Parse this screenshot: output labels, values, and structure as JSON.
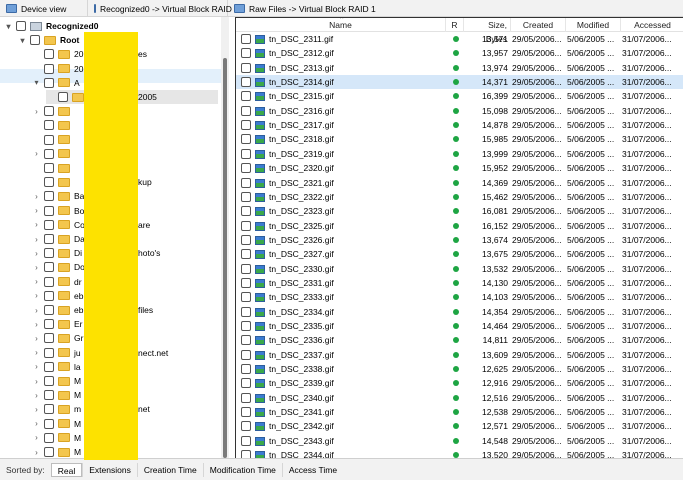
{
  "tabs": [
    {
      "label": "Device view"
    },
    {
      "label": "Recognized0 -> Virtual Block RAID 1"
    },
    {
      "label": "Raw Files -> Virtual Block RAID 1"
    }
  ],
  "tree": [
    {
      "label": "Recognized0",
      "bold": true,
      "expander": "▾"
    },
    {
      "label": "Root",
      "bold": true,
      "expander": "▾"
    },
    {
      "label": "20",
      "tail": "es"
    },
    {
      "label": "20"
    },
    {
      "label": "A",
      "expander": "▾"
    },
    {
      "label": "",
      "tail": "2005"
    },
    {
      "label": "",
      "expander": "›"
    },
    {
      "label": ""
    },
    {
      "label": ""
    },
    {
      "label": "",
      "expander": "›"
    },
    {
      "label": ""
    },
    {
      "label": "",
      "tail": "kup"
    },
    {
      "label": "Ba",
      "expander": "›"
    },
    {
      "label": "Bo",
      "expander": "›"
    },
    {
      "label": "Co",
      "tail": "are",
      "expander": "›"
    },
    {
      "label": "Da",
      "expander": "›"
    },
    {
      "label": "Di",
      "tail": "hoto's",
      "expander": "›"
    },
    {
      "label": "Do",
      "expander": "›"
    },
    {
      "label": "dr",
      "expander": "›"
    },
    {
      "label": "eb",
      "expander": "›"
    },
    {
      "label": "eb",
      "tail": "files",
      "expander": "›"
    },
    {
      "label": "Er",
      "expander": "›"
    },
    {
      "label": "Gr",
      "expander": "›"
    },
    {
      "label": "ju",
      "tail": "nect.net",
      "expander": "›"
    },
    {
      "label": "la",
      "expander": "›"
    },
    {
      "label": "M",
      "expander": "›"
    },
    {
      "label": "M",
      "expander": "›"
    },
    {
      "label": "m",
      "tail": "net",
      "expander": "›"
    },
    {
      "label": "M",
      "expander": "›"
    },
    {
      "label": "M",
      "expander": "›"
    },
    {
      "label": "M",
      "expander": "›"
    }
  ],
  "columns": {
    "name": "Name",
    "r": "R",
    "size": "Size, Bytes",
    "created": "Created",
    "modified": "Modified",
    "accessed": "Accessed"
  },
  "files": [
    {
      "name": "tn_DSC_2311.gif",
      "size": "13,571"
    },
    {
      "name": "tn_DSC_2312.gif",
      "size": "13,957"
    },
    {
      "name": "tn_DSC_2313.gif",
      "size": "13,974"
    },
    {
      "name": "tn_DSC_2314.gif",
      "size": "14,371"
    },
    {
      "name": "tn_DSC_2315.gif",
      "size": "16,399"
    },
    {
      "name": "tn_DSC_2316.gif",
      "size": "15,098"
    },
    {
      "name": "tn_DSC_2317.gif",
      "size": "14,878"
    },
    {
      "name": "tn_DSC_2318.gif",
      "size": "15,985"
    },
    {
      "name": "tn_DSC_2319.gif",
      "size": "13,999"
    },
    {
      "name": "tn_DSC_2320.gif",
      "size": "15,952"
    },
    {
      "name": "tn_DSC_2321.gif",
      "size": "14,369"
    },
    {
      "name": "tn_DSC_2322.gif",
      "size": "15,462"
    },
    {
      "name": "tn_DSC_2323.gif",
      "size": "16,081"
    },
    {
      "name": "tn_DSC_2325.gif",
      "size": "16,152"
    },
    {
      "name": "tn_DSC_2326.gif",
      "size": "13,674"
    },
    {
      "name": "tn_DSC_2327.gif",
      "size": "13,675"
    },
    {
      "name": "tn_DSC_2330.gif",
      "size": "13,532"
    },
    {
      "name": "tn_DSC_2331.gif",
      "size": "14,130"
    },
    {
      "name": "tn_DSC_2333.gif",
      "size": "14,103"
    },
    {
      "name": "tn_DSC_2334.gif",
      "size": "14,354"
    },
    {
      "name": "tn_DSC_2335.gif",
      "size": "14,464"
    },
    {
      "name": "tn_DSC_2336.gif",
      "size": "14,811"
    },
    {
      "name": "tn_DSC_2337.gif",
      "size": "13,609"
    },
    {
      "name": "tn_DSC_2338.gif",
      "size": "12,625"
    },
    {
      "name": "tn_DSC_2339.gif",
      "size": "12,916"
    },
    {
      "name": "tn_DSC_2340.gif",
      "size": "12,516"
    },
    {
      "name": "tn_DSC_2341.gif",
      "size": "12,538"
    },
    {
      "name": "tn_DSC_2342.gif",
      "size": "12,571"
    },
    {
      "name": "tn_DSC_2343.gif",
      "size": "14,548"
    },
    {
      "name": "tn_DSC_2344.gif",
      "size": "13,520"
    }
  ],
  "file_dates": {
    "created": "29/05/2006...",
    "modified": "5/06/2005 ...",
    "accessed": "31/07/2006..."
  },
  "selected_index": 3,
  "sortbar": {
    "label": "Sorted by:",
    "buttons": [
      "Real",
      "Extensions",
      "Creation Time",
      "Modification Time",
      "Access Time"
    ],
    "active": "Real"
  },
  "colors": {
    "recovery_ok": "#1ea543",
    "selection": "#d5e7f9",
    "redaction": "#fde200"
  }
}
